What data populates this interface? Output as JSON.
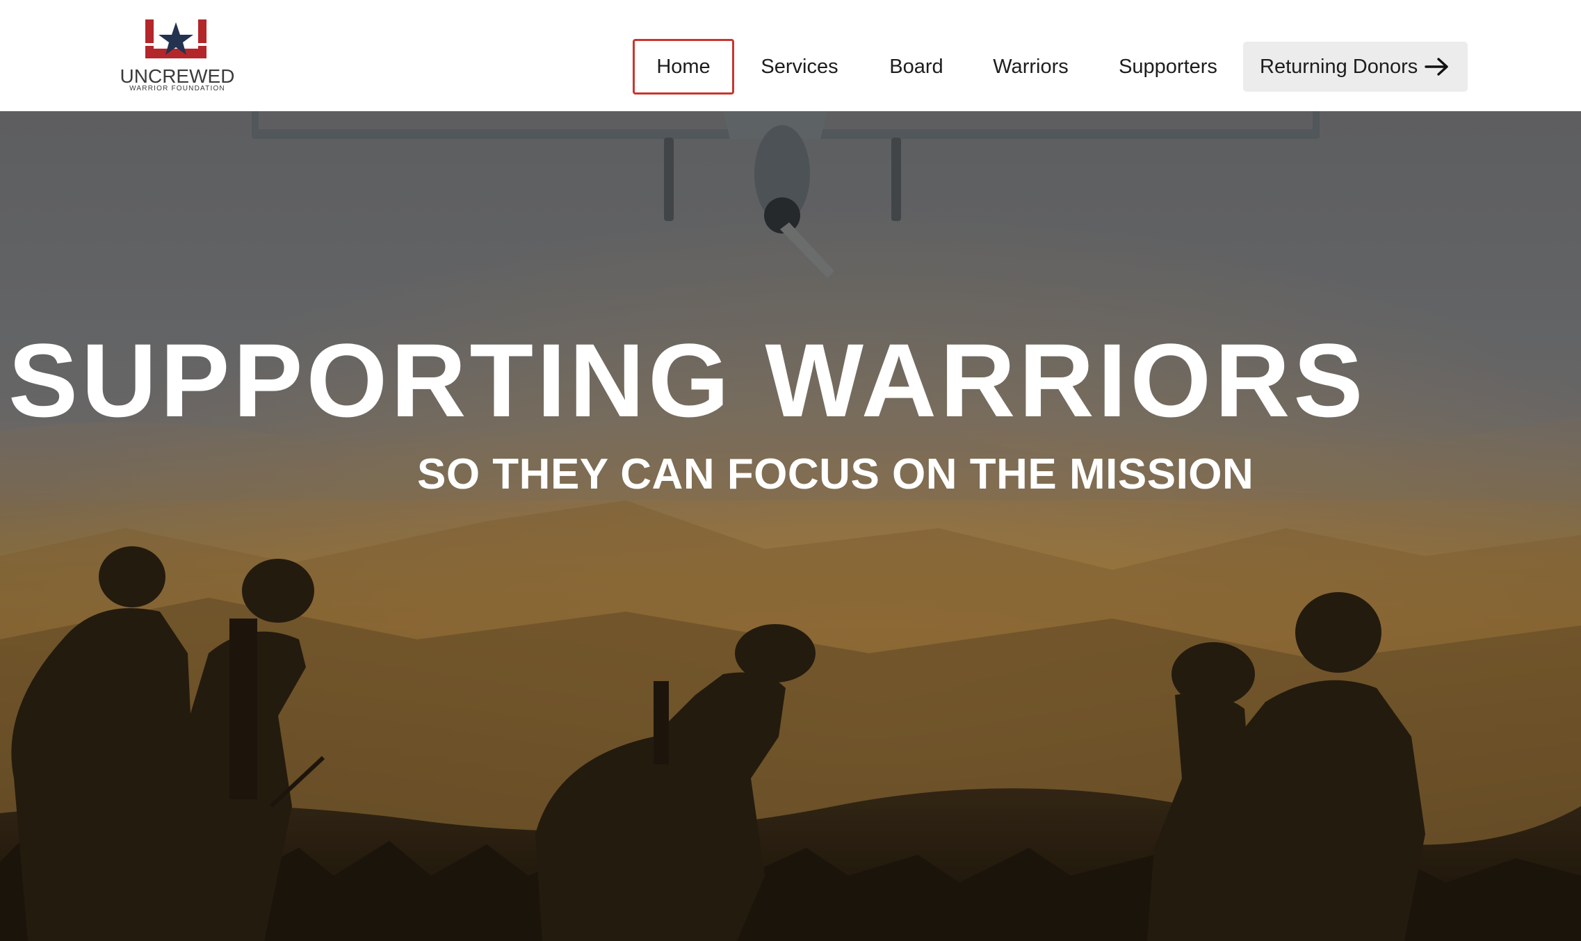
{
  "brand": {
    "name": "UNCREWED",
    "tagline": "WARRIOR FOUNDATION",
    "logo_icon": "star-u-logo-icon",
    "colors": {
      "red": "#b3262a",
      "navy": "#23324f"
    }
  },
  "nav": {
    "items": [
      {
        "label": "Home",
        "active": true
      },
      {
        "label": "Services"
      },
      {
        "label": "Board"
      },
      {
        "label": "Warriors"
      },
      {
        "label": "Supporters"
      }
    ],
    "cta": {
      "label": "Returning Donors",
      "icon": "arrow-right-icon"
    },
    "active_border_color": "#c8362f"
  },
  "hero": {
    "title": "SUPPORTING WARRIORS",
    "subtitle": "SO THEY CAN FOCUS ON THE MISSION",
    "image": "drone-and-soldiers-silhouette-sunset"
  }
}
